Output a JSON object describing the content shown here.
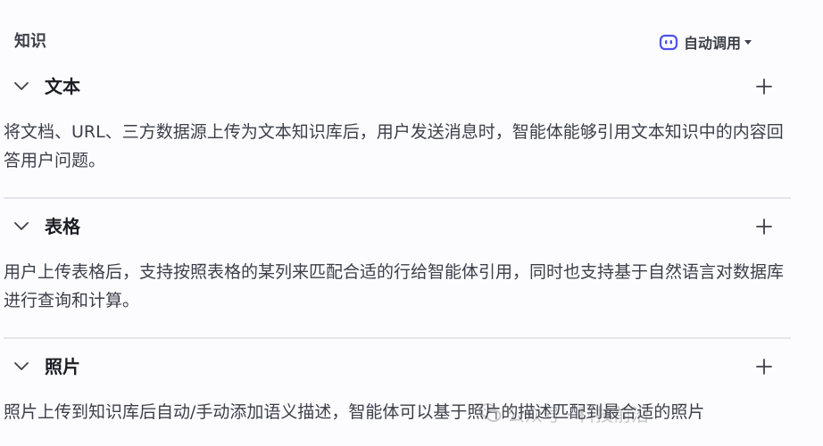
{
  "header": {
    "title": "知识",
    "auto_call_label": "自动调用",
    "auto_call_icon": "bot-icon",
    "caret_icon": "caret-down-icon"
  },
  "groups": [
    {
      "name": "文本",
      "description": "将文档、URL、三方数据源上传为文本知识库后，用户发送消息时，智能体能够引用文本知识中的内容回答用户问题。",
      "expanded": true
    },
    {
      "name": "表格",
      "description": "用户上传表格后，支持按照表格的某列来匹配合适的行给智能体引用，同时也支持基于自然语言对数据库进行查询和计算。",
      "expanded": true
    },
    {
      "name": "照片",
      "description": "照片上传到知识库后自动/手动添加语义描述，智能体可以基于照片的描述匹配到最合适的照片",
      "expanded": true
    }
  ],
  "watermark": {
    "text": "公众号 · 科技前沿",
    "icon": "wechat-icon"
  },
  "colors": {
    "background": "#fcfcff",
    "text_primary": "#1c1d23",
    "text_secondary": "#3d3f49",
    "accent": "#4d53e8",
    "divider": "#e4e5ee"
  }
}
